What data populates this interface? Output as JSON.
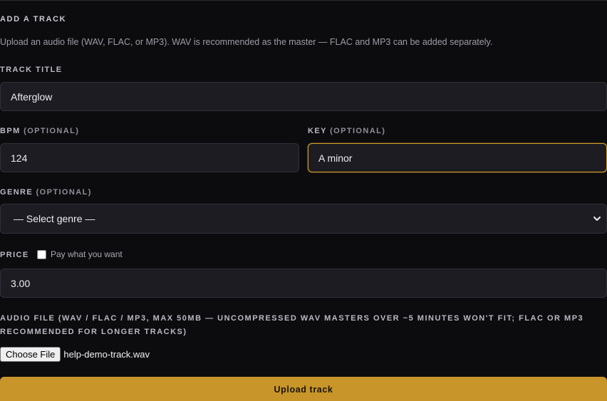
{
  "form": {
    "section_title": "ADD A TRACK",
    "help_text": "Upload an audio file (WAV, FLAC, or MP3). WAV is recommended as the master — FLAC and MP3 can be added separately.",
    "title": {
      "label": "TRACK TITLE",
      "value": "Afterglow"
    },
    "bpm": {
      "label": "BPM",
      "optional": "(OPTIONAL)",
      "value": "124"
    },
    "key": {
      "label": "KEY",
      "optional": "(OPTIONAL)",
      "value": "A minor"
    },
    "genre": {
      "label": "GENRE",
      "optional": "(OPTIONAL)",
      "selected": "— Select genre —"
    },
    "price": {
      "label": "PRICE",
      "pwyw_label": "Pay what you want",
      "pwyw_checked": false,
      "value": "3.00"
    },
    "audio": {
      "label": "AUDIO FILE (WAV / FLAC / MP3, MAX 50MB — UNCOMPRESSED WAV MASTERS OVER ~5 MINUTES WON'T FIT; FLAC OR MP3 RECOMMENDED FOR LONGER TRACKS)",
      "choose_button": "Choose File",
      "file_name": "help-demo-track.wav"
    },
    "submit_label": "Upload track"
  },
  "colors": {
    "background": "#0c0c0f",
    "field_bg": "#1c1c22",
    "accent": "#c8952a",
    "focus_border": "#d4a02a"
  }
}
